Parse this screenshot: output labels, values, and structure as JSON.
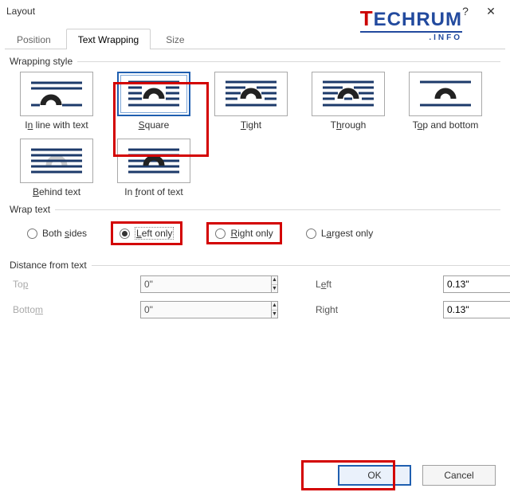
{
  "dialog": {
    "title": "Layout"
  },
  "brand": {
    "t": "T",
    "rest": "ECHRUM",
    "sub": ".INFO"
  },
  "tabs": [
    "Position",
    "Text Wrapping",
    "Size"
  ],
  "active_tab": 1,
  "groups": {
    "wrapping_style": "Wrapping style",
    "wrap_text": "Wrap text",
    "distance": "Distance from text"
  },
  "styles": [
    {
      "name": "inline",
      "accel": "n",
      "rest": "line with text",
      "selected": false
    },
    {
      "name": "square",
      "accel": "S",
      "rest": "quare",
      "selected": true
    },
    {
      "name": "tight",
      "accel": "T",
      "rest": "ight",
      "selected": false
    },
    {
      "name": "through",
      "accel": "h",
      "rest": "rough",
      "selected": false
    },
    {
      "name": "topbottom",
      "accel": "o",
      "rest": "p and bottom",
      "selected": false
    },
    {
      "name": "behind",
      "accel": "B",
      "rest": "ehind text",
      "selected": false
    },
    {
      "name": "infront",
      "accel": "f",
      "rest": "ront of text",
      "selected": false
    }
  ],
  "wrap_text": [
    {
      "name": "both",
      "pre": "Both ",
      "accel": "s",
      "rest": "ides",
      "selected": false
    },
    {
      "name": "left",
      "pre": "",
      "accel": "L",
      "rest": "eft only",
      "selected": true
    },
    {
      "name": "right",
      "pre": "",
      "accel": "R",
      "rest": "ight only",
      "selected": false
    },
    {
      "name": "largest",
      "pre": "L",
      "accel": "a",
      "rest": "rgest only",
      "selected": false
    }
  ],
  "distance": {
    "top": {
      "pre": "To",
      "accel": "p",
      "rest": "",
      "value": "0\"",
      "enabled": false
    },
    "bottom": {
      "pre": "Botto",
      "accel": "m",
      "rest": "",
      "value": "0\"",
      "enabled": false
    },
    "left": {
      "pre": "L",
      "accel": "e",
      "rest": "ft",
      "value": "0.13\"",
      "enabled": true
    },
    "right": {
      "pre": "Ri",
      "accel": "g",
      "rest": "ht",
      "value": "0.13\"",
      "enabled": true
    }
  },
  "buttons": {
    "ok": "OK",
    "cancel": "Cancel"
  }
}
